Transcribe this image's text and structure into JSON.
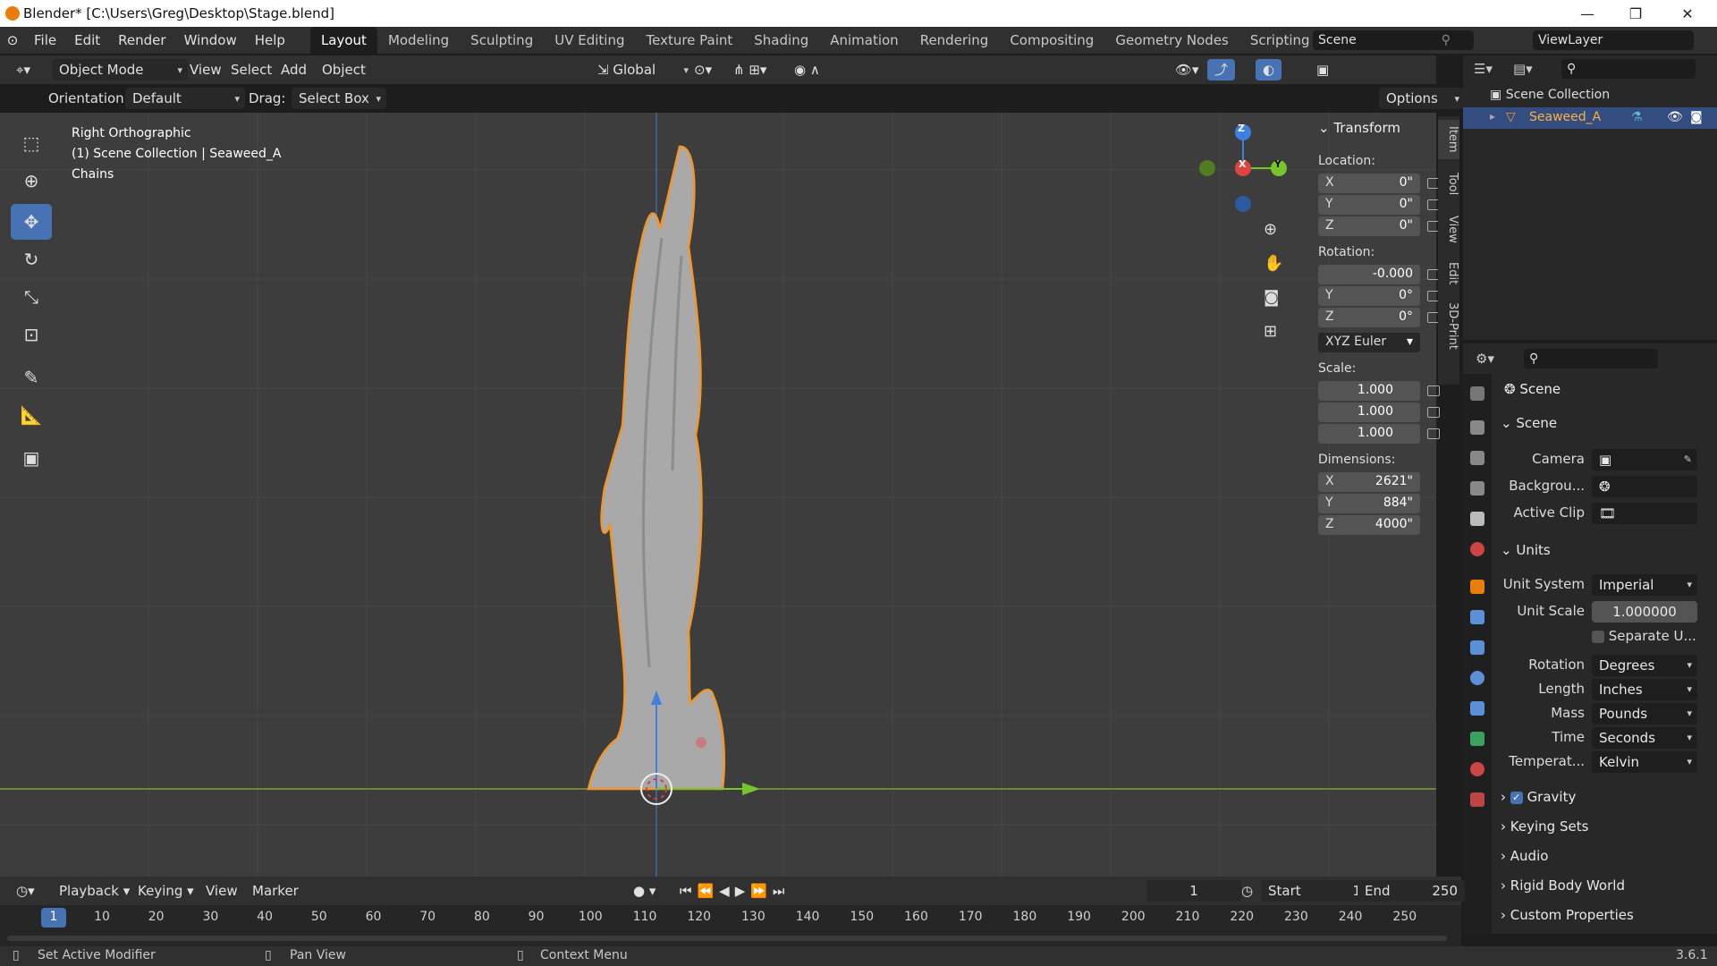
{
  "window": {
    "title": "Blender* [C:\\Users\\Greg\\Desktop\\Stage.blend]",
    "minimize": "—",
    "maximize": "❐",
    "close": "✕"
  },
  "menu": {
    "items": [
      "File",
      "Edit",
      "Render",
      "Window",
      "Help"
    ]
  },
  "workspaces": {
    "tabs": [
      "Layout",
      "Modeling",
      "Sculpting",
      "UV Editing",
      "Texture Paint",
      "Shading",
      "Animation",
      "Rendering",
      "Compositing",
      "Geometry Nodes",
      "Scripting"
    ],
    "active": "Layout",
    "add": "+"
  },
  "scene_selector": {
    "value": "Scene"
  },
  "viewlayer_selector": {
    "value": "ViewLayer"
  },
  "header": {
    "mode": "Object Mode",
    "view": "View",
    "select": "Select",
    "add": "Add",
    "object": "Object",
    "transform_orientation": "Global"
  },
  "tool_header": {
    "orientation_label": "Orientation:",
    "orientation_value": "Default",
    "drag_label": "Drag:",
    "drag_value": "Select Box",
    "options": "Options"
  },
  "viewport_info": {
    "view": "Right Orthographic",
    "collection": "(1) Scene Collection | Seaweed_A",
    "extra": "Chains"
  },
  "gizmo": {
    "z": "Z",
    "x": "X",
    "y": "Y"
  },
  "transform": {
    "title": "Transform",
    "location_label": "Location:",
    "location": [
      {
        "axis": "X",
        "value": "0\""
      },
      {
        "axis": "Y",
        "value": "0\""
      },
      {
        "axis": "Z",
        "value": "0\""
      }
    ],
    "rotation_label": "Rotation:",
    "rotation": [
      {
        "axis": "",
        "value": "-0.000"
      },
      {
        "axis": "Y",
        "value": "0°"
      },
      {
        "axis": "Z",
        "value": "0°"
      }
    ],
    "rotation_mode": "XYZ Euler",
    "scale_label": "Scale:",
    "scale": [
      "1.000",
      "1.000",
      "1.000"
    ],
    "dimensions_label": "Dimensions:",
    "dimensions": [
      {
        "axis": "X",
        "value": "2621\""
      },
      {
        "axis": "Y",
        "value": "884\""
      },
      {
        "axis": "Z",
        "value": "4000\""
      }
    ]
  },
  "npanel_tabs": [
    "Item",
    "Tool",
    "View",
    "Edit",
    "3D-Print"
  ],
  "outliner": {
    "root": "Scene Collection",
    "item": "Seaweed_A"
  },
  "properties": {
    "context": "Scene",
    "scene_section": "Scene",
    "camera_label": "Camera",
    "background_label": "Backgrou...",
    "active_clip_label": "Active Clip",
    "units_section": "Units",
    "unit_system_label": "Unit System",
    "unit_system": "Imperial",
    "unit_scale_label": "Unit Scale",
    "unit_scale": "1.000000",
    "separate_units": "Separate U...",
    "rotation_label": "Rotation",
    "rotation": "Degrees",
    "length_label": "Length",
    "length": "Inches",
    "mass_label": "Mass",
    "mass": "Pounds",
    "time_label": "Time",
    "time": "Seconds",
    "temperature_label": "Temperat...",
    "temperature": "Kelvin",
    "gravity": "Gravity",
    "keying_sets": "Keying Sets",
    "audio": "Audio",
    "rigid_body": "Rigid Body World",
    "custom_props": "Custom Properties"
  },
  "timeline": {
    "playback": "Playback",
    "keying": "Keying",
    "view": "View",
    "marker": "Marker",
    "current_frame": "1",
    "start_label": "Start",
    "start": "1",
    "end_label": "End",
    "end": "250",
    "ticks": [
      "1",
      "10",
      "20",
      "30",
      "40",
      "50",
      "60",
      "70",
      "80",
      "90",
      "100",
      "110",
      "120",
      "130",
      "140",
      "150",
      "160",
      "170",
      "180",
      "190",
      "200",
      "210",
      "220",
      "230",
      "240",
      "250"
    ]
  },
  "status": {
    "left": "Set Active Modifier",
    "middle": "Pan View",
    "right": "Context Menu",
    "version": "3.6.1"
  }
}
